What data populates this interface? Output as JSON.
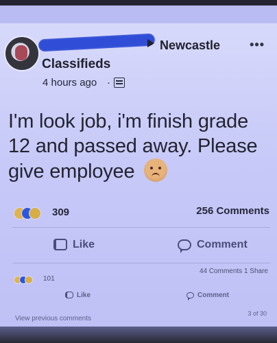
{
  "post": {
    "group_name": "Newcastle",
    "subname": "Classifieds",
    "time": "4 hours ago",
    "text": "I'm look job, i'm finish grade 12 and passed away. Please give employee",
    "more_icon": "more-icon"
  },
  "stats": {
    "reaction_count": "309",
    "comments": "256 Comments"
  },
  "actions": {
    "like_label": "Like",
    "comment_label": "Comment"
  },
  "secondary": {
    "reaction_count": "101",
    "comments": "44 Comments  1 Share",
    "like_label": "Like",
    "comment_label": "Comment",
    "view_previous": "View previous comments",
    "page_count": "3 of 30"
  },
  "icons": {
    "avatar": "avatar",
    "privacy": "privacy-icon",
    "like": "like-icon",
    "comment": "comment-icon",
    "sad": "sad-emoji-icon"
  },
  "colors": {
    "background": "#b9bbf3",
    "text": "#232331",
    "accent": "#2c57dd"
  }
}
